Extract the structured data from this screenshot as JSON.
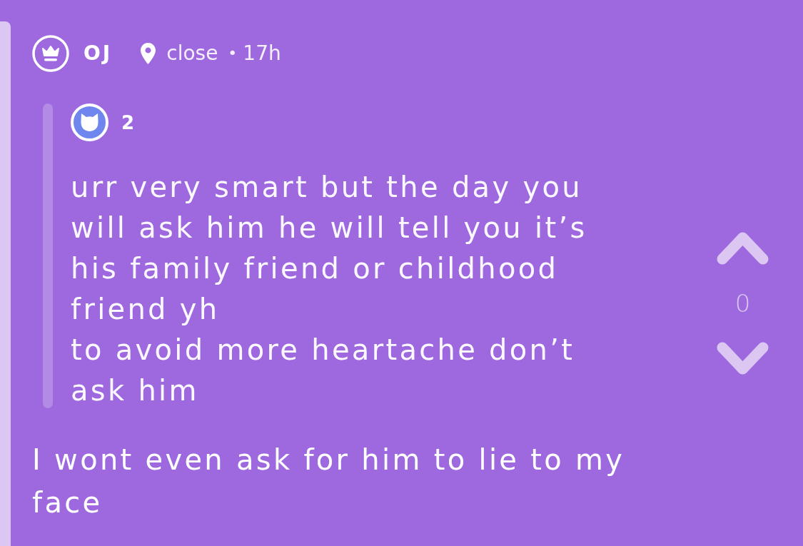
{
  "post": {
    "author": {
      "name": "OJ"
    },
    "location": "close",
    "separator": "•",
    "age": "17h",
    "quote": {
      "author": "2",
      "text": "urr very smart but the day you\nwill ask him he will tell you it’s\nhis family friend or childhood\nfriend yh\nto avoid more heartache don’t\nask him"
    },
    "text": "I wont even ask for him to lie to my\nface",
    "votes": {
      "count": "0"
    }
  }
}
